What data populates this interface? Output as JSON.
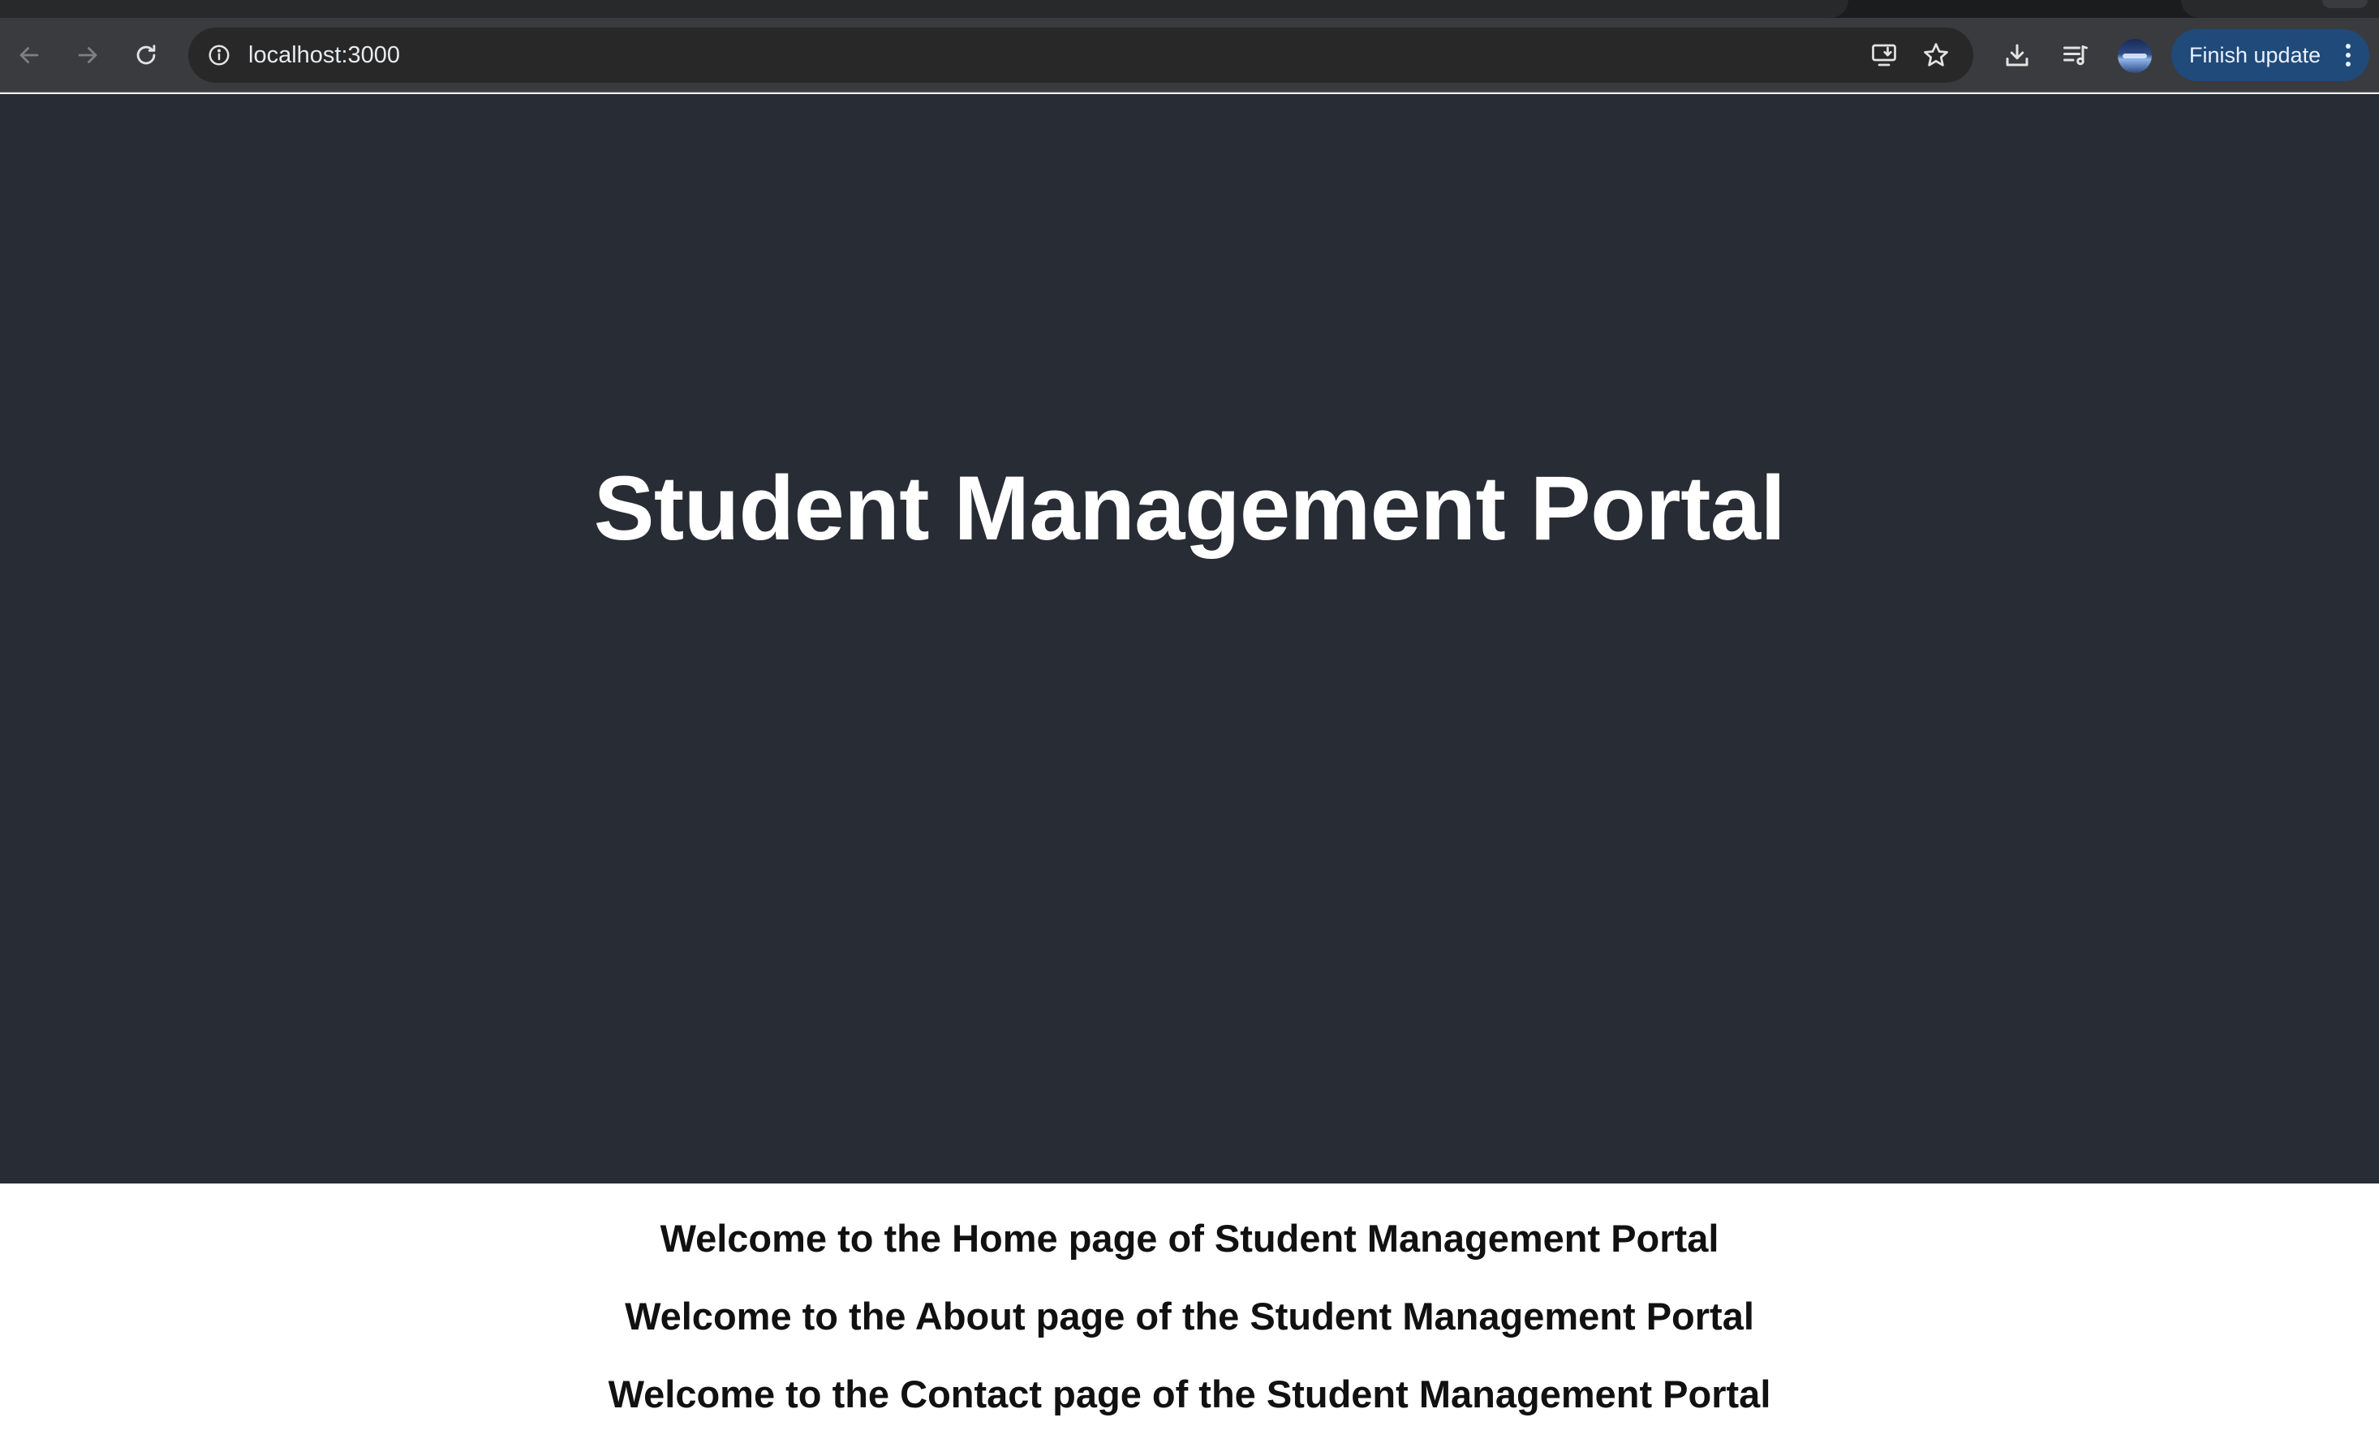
{
  "browser": {
    "address_bar": {
      "url": "localhost:3000"
    },
    "update_button": {
      "label": "Finish update"
    },
    "icons": {
      "back": "back-arrow-icon",
      "forward": "forward-arrow-icon",
      "reload": "reload-icon",
      "site_info": "info-icon",
      "install_app": "install-app-icon",
      "bookmark": "star-icon",
      "downloads": "download-icon",
      "media_queue": "reading-list-icon",
      "profile": "avatar",
      "menu": "kebab-menu-icon"
    },
    "colors": {
      "toolbar": "#3a3b3e",
      "omnibox": "#282828",
      "update_button": "#1f4a7a"
    }
  },
  "page": {
    "header": {
      "title": "Student Management Portal",
      "background": "#282c34"
    },
    "welcome_messages": [
      "Welcome to the Home page of Student Management Portal",
      "Welcome to the About page of the Student Management Portal",
      "Welcome to the Contact page of the Student Management Portal"
    ]
  }
}
